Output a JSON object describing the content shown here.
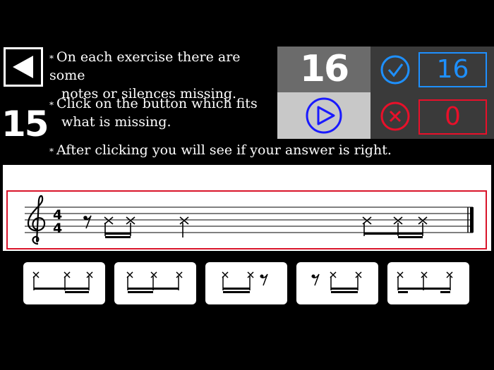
{
  "exercise": {
    "number": "15",
    "back_icon": "left-triangle-icon"
  },
  "instructions": [
    {
      "line1": "On each exercise there are some",
      "line2": "notes or silences missing."
    },
    {
      "line1": "Click on the button which fits",
      "line2": "what is missing."
    },
    {
      "line1": "After clicking you will see if your answer is right.",
      "line2": ""
    }
  ],
  "score": {
    "total": "16",
    "correct": "16",
    "wrong": "0",
    "correct_color": "#1e90ff",
    "wrong_color": "#e8102a",
    "play_icon": "play-icon",
    "correct_icon": "check-circle-icon",
    "wrong_icon": "x-circle-icon"
  },
  "staff": {
    "clef": "treble",
    "time_signature": "4/4",
    "frame_color": "#d9142a"
  },
  "answers": [
    {
      "id": "option-1",
      "pattern": "eighth + two sixteenths"
    },
    {
      "id": "option-2",
      "pattern": "two sixteenths + eighth"
    },
    {
      "id": "option-3",
      "pattern": "two sixteenths + eighth rest"
    },
    {
      "id": "option-4",
      "pattern": "eighth rest + two sixteenths"
    },
    {
      "id": "option-5",
      "pattern": "sixteenth + eighth + sixteenth"
    }
  ]
}
